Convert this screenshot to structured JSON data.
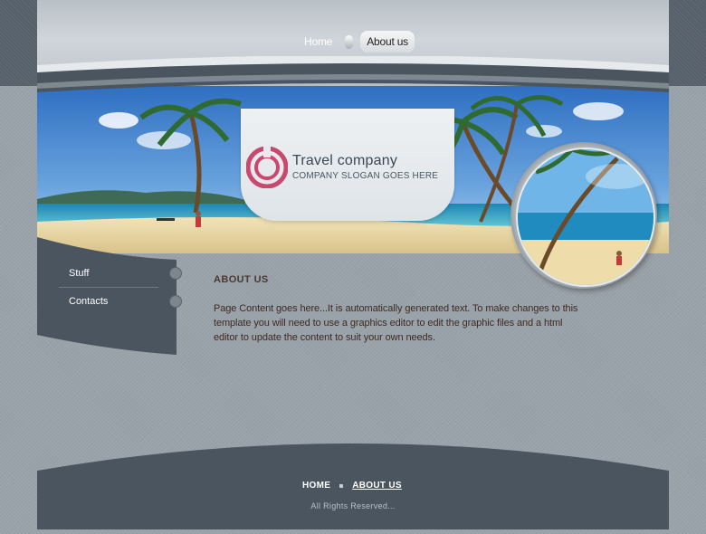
{
  "nav": {
    "items": [
      {
        "label": "Home",
        "active": false
      },
      {
        "label": "About us",
        "active": true
      }
    ]
  },
  "logo": {
    "title": "Travel company",
    "slogan": "COMPANY SLOGAN GOES HERE",
    "icon": "ring-logo-icon"
  },
  "sidebar": {
    "items": [
      {
        "label": "Stuff"
      },
      {
        "label": "Contacts"
      }
    ]
  },
  "content": {
    "title": "ABOUT US",
    "text": "Page Content goes here...It is automatically generated text. To make changes to this template you will need to use a graphics editor to edit the graphic files and a html editor to update the content to suit your own needs."
  },
  "footer": {
    "links": [
      {
        "label": "HOME",
        "active": false
      },
      {
        "label": "ABOUT US",
        "active": true
      }
    ],
    "copyright": "All Rights Reserved..."
  },
  "colors": {
    "accent": "#c9486e",
    "dark_panel": "#4a5560",
    "background": "#9aa2aa"
  }
}
